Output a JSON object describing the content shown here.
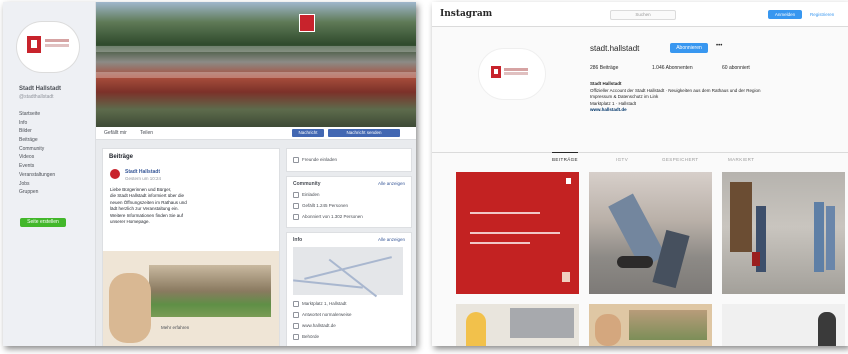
{
  "facebook": {
    "page_name": "Stadt Hallstadt",
    "handle": "@stadthallstadt",
    "nav_items": [
      "Startseite",
      "Info",
      "Bilder",
      "Beiträge",
      "Community",
      "Videos",
      "Events",
      "Veranstaltungen",
      "Jobs",
      "Gruppen"
    ],
    "create_button": "Seite erstellen",
    "tabs": [
      "Gefällt mir",
      "Teilen"
    ],
    "buttons": [
      "Nachricht",
      "Nachricht senden"
    ],
    "feed_title": "Beiträge",
    "post": {
      "author": "Stadt Hallstadt",
      "time": "Gestern um 10:24",
      "text": [
        "Liebe Bürgerinnen und Bürger,",
        "die Stadt Hallstadt informiert über die",
        "neuen Öffnungszeiten im Rathaus und",
        "lädt herzlich zur Veranstaltung ein.",
        "Weitere Informationen finden Sie auf",
        "unserer Homepage."
      ],
      "image_caption": "Mehr erfahren"
    },
    "right_cards": {
      "invite": "Freunde einladen",
      "community_title": "Community",
      "community_link": "Alle anzeigen",
      "community_rows": [
        "Einladen",
        "Gefällt 1.245 Personen",
        "Abonniert von 1.302 Personen"
      ],
      "info_title": "Info",
      "info_link": "Alle anzeigen",
      "info_rows": [
        "Marktplatz 1, Hallstadt",
        "Antwortet normalerweise",
        "www.hallstadt.de",
        "Behörde"
      ]
    },
    "colors": {
      "brand_blue": "#4267b2",
      "crest_red": "#c8232c",
      "green": "#42b72a"
    }
  },
  "instagram": {
    "brand": "Instagram",
    "search_placeholder": "Suchen",
    "top_button": "Anmelden",
    "top_link": "Registrieren",
    "username": "stadt.hallstadt",
    "follow_button": "Abonnieren",
    "more": "•••",
    "stats": [
      "286 Beiträge",
      "1.046 Abonnenten",
      "60 abonniert"
    ],
    "bio": {
      "name": "Stadt Hallstadt",
      "lines": [
        "Offizieller Account der Stadt Hallstadt · Neuigkeiten aus dem Rathaus und der Region",
        "Impressum & Datenschutz im Link",
        "Marktplatz 1 · Hallstadt"
      ],
      "link": "www.hallstadt.de"
    },
    "tabs": [
      "BEITRÄGE",
      "IGTV",
      "GESPEICHERT",
      "MARKIERT"
    ],
    "active_tab": "BEITRÄGE",
    "colors": {
      "accent": "#3897f0",
      "tile_red": "#c32222"
    }
  }
}
